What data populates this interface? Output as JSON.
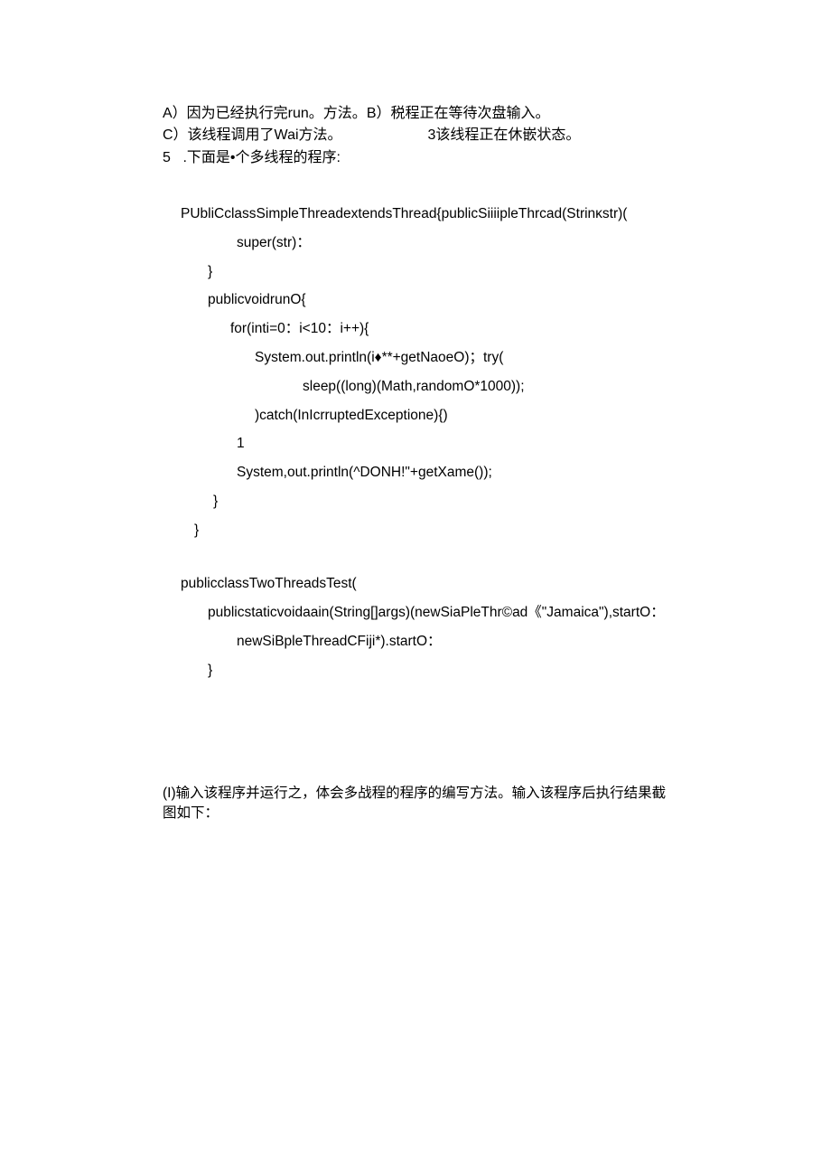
{
  "q4": {
    "optA": "A）因为已经执行完run。方法。",
    "optB": "B）税程正在等待次盘输入。",
    "optC": "C）该线程调用了Wai方法。",
    "optD": "3该线程正在休嵌状态。"
  },
  "q5": {
    "num": "5",
    "title": " .下面是•个多线程的程序:"
  },
  "code": {
    "l1": "PUbliCclassSimpleThreadextendsThread{publicSiiiipleThrcad(Strinκstr)(",
    "l2": "super(str)：",
    "l3": "}",
    "l4": "publicvoidrunO{",
    "l5": "for(inti=0：i<10：i++){",
    "l6": "System.out.println(i♦**+getNaoeO)；try(",
    "l7": "sleep((long)(Math,randomO*1000));",
    "l8": ")catch(InIcrruptedExceptione){)",
    "l9": "1",
    "l10": "System,out.println(^DONH!\"+getXame());",
    "l11": "}",
    "l12": "}",
    "l13": "publicclassTwoThreadsTest(",
    "l14": "publicstaticvoidaain(String[]args)(newSiaPleThr©ad《\"Jamaica\"),startO：",
    "l15": "newSiBpleThreadCFiji*).startO：",
    "l16": "}"
  },
  "footer": "(I)输入该程序并运行之，体会多战程的程序的编写方法。输入该程序后执行结果截图如下："
}
